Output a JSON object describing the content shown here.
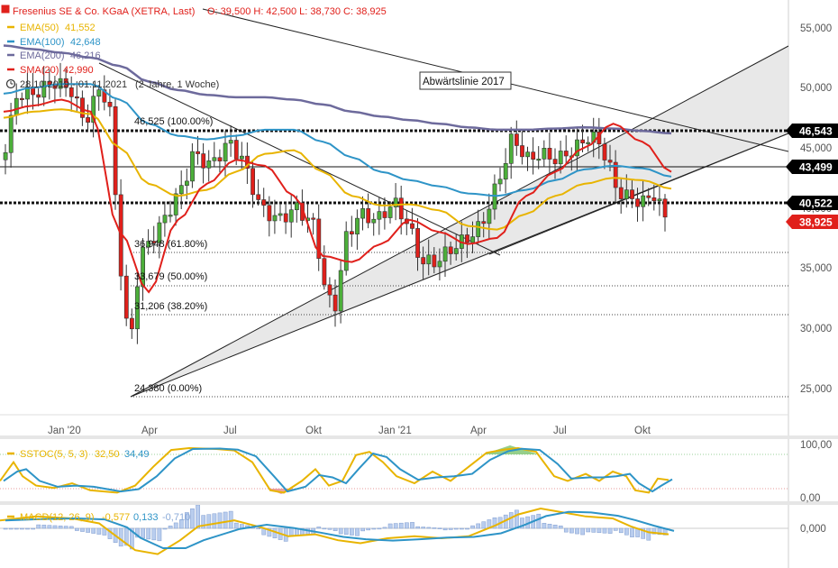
{
  "header": {
    "title": "Fresenius SE & Co. KGaA (XETRA, Last)",
    "ohlc": "O: 39,500  H: 42,500  L: 38,730  C: 38,925",
    "period": "28.10.2019 - 01.11.2021",
    "period_note": "(2 Jahre, 1 Woche)"
  },
  "legend": [
    {
      "label": "EMA(50)",
      "value": "41,552",
      "color": "#e8b400"
    },
    {
      "label": "EMA(100)",
      "value": "42,648",
      "color": "#2e94c7"
    },
    {
      "label": "EMA(200)",
      "value": "46,216",
      "color": "#6d6a9c"
    },
    {
      "label": "SMA(20)",
      "value": "42,990",
      "color": "#e0201b"
    }
  ],
  "trendline_label": "Abwärtslinie 2017",
  "fib_levels": [
    {
      "label": "46,525 (100.00%)",
      "value": 46.525
    },
    {
      "label": "36,948 (61.80%)",
      "value": 36.948
    },
    {
      "label": "33,679 (50.00%)",
      "value": 33.679
    },
    {
      "label": "31,206 (38.20%)",
      "value": 31.206
    },
    {
      "label": "24,380 (0.00%)",
      "value": 24.38
    }
  ],
  "price_markers": [
    {
      "label": "46,543",
      "value": 46.543,
      "bg": "#000000"
    },
    {
      "label": "43,499",
      "value": 43.499,
      "bg": "#000000"
    },
    {
      "label": "40,522",
      "value": 40.522,
      "bg": "#000000"
    },
    {
      "label": "38,925",
      "value": 38.925,
      "bg": "#e0201b"
    }
  ],
  "price_axis": {
    "ticks": [
      "55,000",
      "50,000",
      "45,000",
      "40,000",
      "35,000",
      "30,000",
      "25,000"
    ]
  },
  "time_axis": {
    "ticks": [
      "Jan '20",
      "Apr",
      "Jul",
      "Okt",
      "Jan '21",
      "Apr",
      "Jul",
      "Okt"
    ]
  },
  "stoch": {
    "label": "SSTOC(5, 5, 3)",
    "v1": "32,50",
    "v2": "34,49",
    "c1": "#e8b400",
    "c2": "#2e94c7",
    "ticks": [
      "100,00",
      "0,00"
    ]
  },
  "macd": {
    "label": "MACD(12, 26, 9)",
    "v1": "-0,577",
    "v2": "0,133",
    "v3": "-0,710",
    "c1": "#e8b400",
    "c2": "#2e94c7",
    "c3": "#8aaad8",
    "ticks": [
      "0,000"
    ]
  },
  "chart_data": {
    "type": "line",
    "title": "Fresenius SE & Co. KGaA (XETRA, Last)",
    "xlabel": "",
    "ylabel": "",
    "ylim": [
      22.5,
      56.5
    ],
    "x": [
      "2019-11",
      "2019-12",
      "2020-01",
      "2020-02",
      "2020-03",
      "2020-04",
      "2020-05",
      "2020-06",
      "2020-07",
      "2020-08",
      "2020-09",
      "2020-10",
      "2020-11",
      "2020-12",
      "2021-01",
      "2021-02",
      "2021-03",
      "2021-04",
      "2021-05",
      "2021-06",
      "2021-07",
      "2021-08",
      "2021-09",
      "2021-10"
    ],
    "series": [
      {
        "name": "EMA(50)",
        "values": [
          47.5,
          48.0,
          48.2,
          47.8,
          45.0,
          42.0,
          41.0,
          41.5,
          43.0,
          44.5,
          44.8,
          43.0,
          41.0,
          40.2,
          40.3,
          39.8,
          38.5,
          38.2,
          39.5,
          41.0,
          42.0,
          42.5,
          42.3,
          41.6
        ]
      },
      {
        "name": "EMA(100)",
        "values": [
          49.5,
          50.0,
          50.3,
          50.3,
          49.0,
          47.0,
          46.0,
          45.7,
          46.0,
          46.5,
          46.5,
          45.5,
          44.2,
          43.0,
          42.3,
          41.8,
          41.2,
          41.0,
          41.5,
          42.3,
          43.2,
          43.5,
          43.3,
          42.6
        ]
      },
      {
        "name": "EMA(200)",
        "values": [
          53.5,
          53.2,
          52.9,
          52.5,
          51.8,
          50.5,
          49.8,
          49.4,
          49.2,
          49.2,
          49.0,
          48.6,
          48.0,
          47.6,
          47.3,
          47.0,
          46.7,
          46.5,
          46.5,
          46.6,
          46.7,
          46.6,
          46.4,
          46.2
        ]
      },
      {
        "name": "SMA(20)",
        "values": [
          48.0,
          48.5,
          49.0,
          48.0,
          38.0,
          33.0,
          39.0,
          42.0,
          44.0,
          43.5,
          41.0,
          36.0,
          35.5,
          37.0,
          39.0,
          38.0,
          37.0,
          37.5,
          41.0,
          43.0,
          45.0,
          47.0,
          45.5,
          43.0
        ]
      }
    ],
    "close_last": 38.925,
    "grid": false,
    "legend_position": "top-left"
  }
}
